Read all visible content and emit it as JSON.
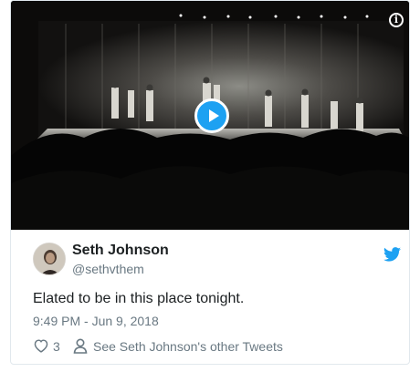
{
  "embed": {
    "video": {
      "play_icon": "play-icon",
      "info_icon": "info-icon",
      "info_glyph": "i"
    },
    "author": {
      "name": "Seth Johnson",
      "handle": "@sethvthem",
      "avatar": "avatar-photo"
    },
    "brand_icon": "twitter-bird-icon",
    "tweet_text": "Elated to be in this place tonight.",
    "timestamp": "9:49 PM - Jun 9, 2018",
    "actions": {
      "like_icon": "heart-icon",
      "like_count": "3",
      "profile_icon": "person-icon",
      "other_tweets_label": "See Seth Johnson's other Tweets"
    }
  },
  "colors": {
    "accent": "#1da1f2",
    "text": "#1c2022",
    "muted": "#697882",
    "border": "#e1e8ed"
  }
}
